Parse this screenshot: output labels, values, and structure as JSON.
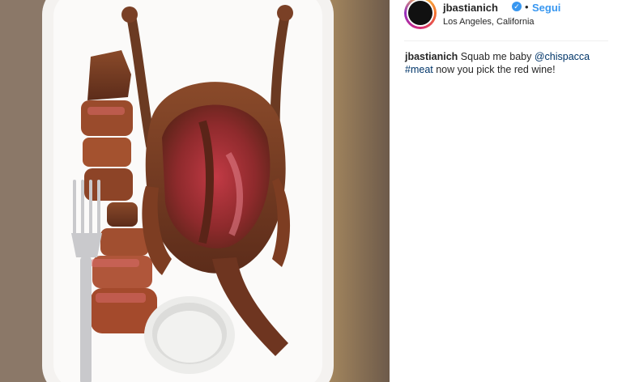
{
  "post": {
    "username": "jbastianich",
    "follow_label": "Segui",
    "location": "Los Angeles, California",
    "separator": "•",
    "verified_icon": "verified-check-icon"
  },
  "caption": {
    "username": "jbastianich",
    "text_1": "Squab me baby",
    "mention": "@chispacca",
    "hashtag": "#meat",
    "text_2": "now you pick the red wine!"
  },
  "colors": {
    "link_blue": "#3897f0",
    "text": "#262626",
    "hashtag": "#003569"
  }
}
